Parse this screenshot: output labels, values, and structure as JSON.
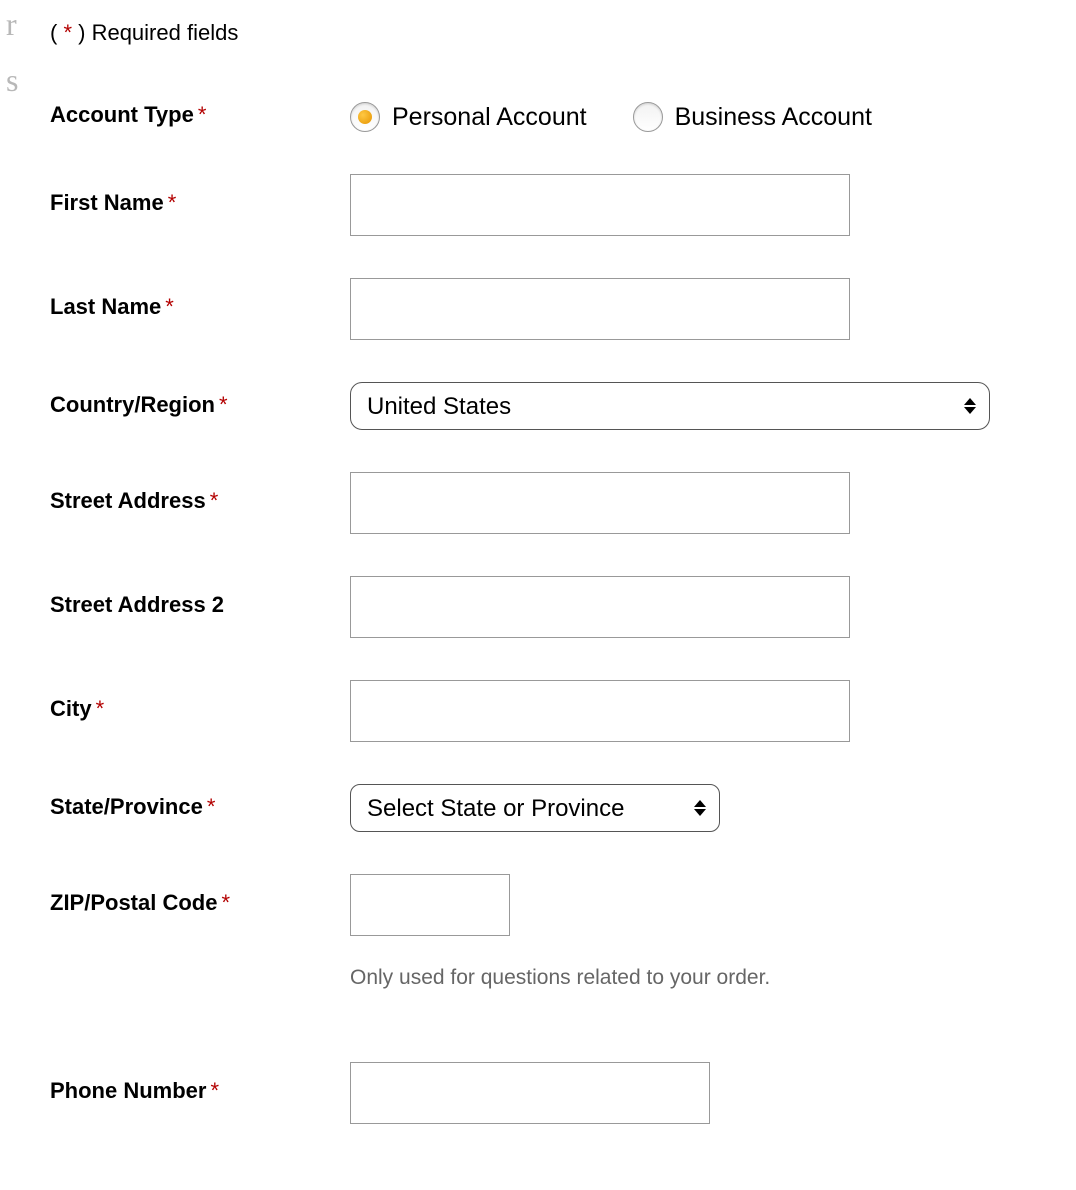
{
  "edge_letters": {
    "r": "r",
    "s": "s"
  },
  "required_note": {
    "open": "( ",
    "star": "*",
    "close": " ) Required fields"
  },
  "labels": {
    "account_type": "Account Type",
    "first_name": "First Name",
    "last_name": "Last Name",
    "country_region": "Country/Region",
    "street_address": "Street Address",
    "street_address_2": "Street Address 2",
    "city": "City",
    "state_province": "State/Province",
    "zip_postal": "ZIP/Postal Code",
    "phone_number": "Phone Number"
  },
  "star": "*",
  "account_type": {
    "options": [
      {
        "label": "Personal Account",
        "selected": true
      },
      {
        "label": "Business Account",
        "selected": false
      }
    ]
  },
  "values": {
    "first_name": "",
    "last_name": "",
    "country_region": "United States",
    "street_address": "",
    "street_address_2": "",
    "city": "",
    "state_province": "Select State or Province",
    "zip_postal": "",
    "phone_number": ""
  },
  "helper": {
    "phone": "Only used for questions related to your order."
  }
}
